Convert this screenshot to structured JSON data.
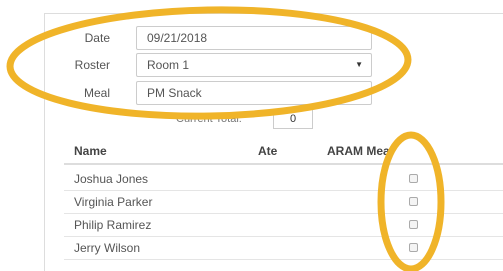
{
  "form": {
    "date_label": "Date",
    "date_value": "09/21/2018",
    "roster_label": "Roster",
    "roster_value": "Room 1",
    "meal_label": "Meal",
    "meal_value": "PM Snack"
  },
  "total": {
    "label": "Current Total:",
    "value": "0"
  },
  "table": {
    "headers": {
      "name": "Name",
      "ate": "Ate",
      "aram": "ARAM Meal"
    },
    "rows": [
      {
        "name": "Joshua Jones",
        "aram_checked": false
      },
      {
        "name": "Virginia Parker",
        "aram_checked": false
      },
      {
        "name": "Philip Ramirez",
        "aram_checked": false
      },
      {
        "name": "Jerry Wilson",
        "aram_checked": false
      }
    ]
  },
  "icons": {
    "dropdown": "chevron-down-icon"
  },
  "colors": {
    "annotation": "#f0b429"
  }
}
